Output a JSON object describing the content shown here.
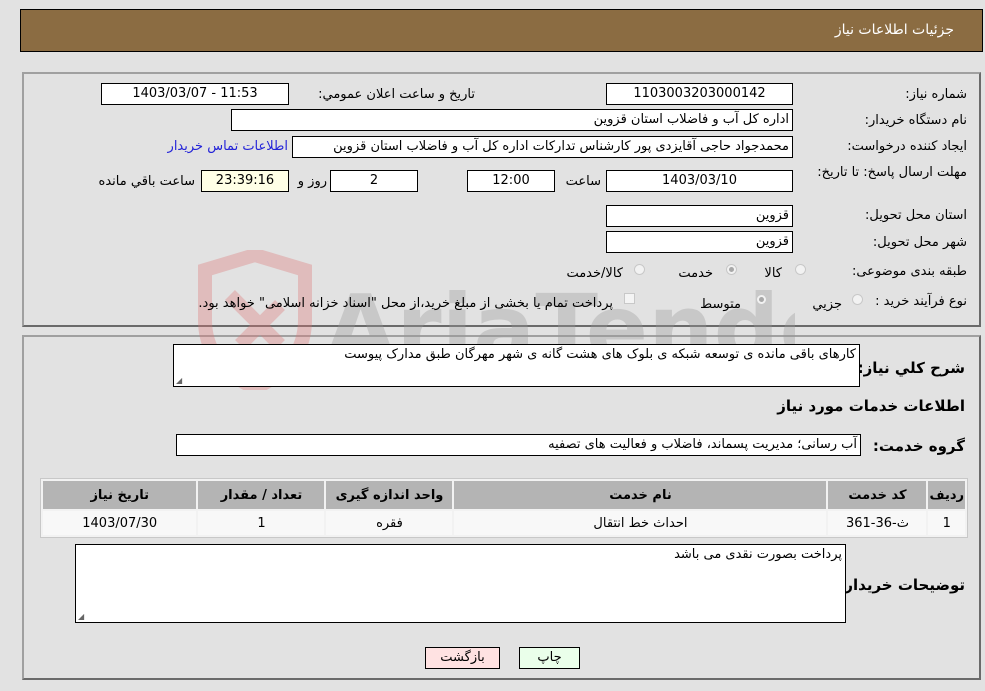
{
  "header": {
    "title": "جزئيات اطلاعات نياز"
  },
  "details": {
    "need_number": {
      "label": "شماره نياز:",
      "value": "1103003203000142"
    },
    "announce_datetime": {
      "label": "تاريخ و ساعت اعلان عمومي:",
      "value": "1403/03/07 - 11:53"
    },
    "buyer_org": {
      "label": "نام دستگاه خريدار:",
      "value": "اداره کل آب و فاضلاب استان قزوین"
    },
    "requester": {
      "label": "ايجاد کننده درخواست:",
      "value": "محمدجواد حاجی آقایزدی پور کارشناس تدارکات اداره کل آب و فاضلاب استان قزوین"
    },
    "contact_link": "اطلاعات تماس خريدار",
    "deadline": {
      "label": "مهلت ارسال پاسخ: تا تاريخ:",
      "date": "1403/03/10",
      "time_label": "ساعت",
      "time": "12:00",
      "days": "2",
      "days_label": "روز و",
      "remaining": "23:39:16",
      "remaining_label": "ساعت باقي مانده"
    },
    "delivery_province": {
      "label": "استان محل تحويل:",
      "value": "قزوین"
    },
    "delivery_city": {
      "label": "شهر محل تحويل:",
      "value": "قزوین"
    },
    "category": {
      "label": "طبقه بندی موضوعی:",
      "options": [
        "كالا",
        "خدمت",
        "كالا/خدمت"
      ],
      "selected": "خدمت"
    },
    "purchase_type": {
      "label": "نوع فرآيند خريد :",
      "options": [
        "جزيي",
        "متوسط"
      ],
      "selected": "متوسط",
      "treasury_note": "پرداخت تمام يا بخشی از مبلغ خريد،از محل \"اسناد خزانه اسلامی\" خواهد بود."
    }
  },
  "description": {
    "label": "شرح کلي نياز:",
    "value": "کارهای باقی مانده ی توسعه شبکه ی بلوک های هشت گانه ی شهر مهرگان طبق مدارک پیوست"
  },
  "services": {
    "section_title": "اطلاعات خدمات مورد نياز",
    "group_label": "گروه خدمت:",
    "group_value": "آب رسانی؛ مدیریت پسماند، فاضلاب و فعالیت های تصفیه",
    "table": {
      "headers": [
        "رديف",
        "کد خدمت",
        "نام خدمت",
        "واحد اندازه گيری",
        "تعداد / مقدار",
        "تاريخ نياز"
      ],
      "rows": [
        [
          "1",
          "ث-36-361",
          "احداث خط انتقال",
          "فقره",
          "1",
          "1403/07/30"
        ]
      ]
    }
  },
  "buyer_notes": {
    "label": "توضيحات خريدار:",
    "value": "پرداخت بصورت نقدی می باشد"
  },
  "buttons": {
    "print": "چاپ",
    "back": "بازگشت"
  },
  "watermark": "AriaTender.neT"
}
